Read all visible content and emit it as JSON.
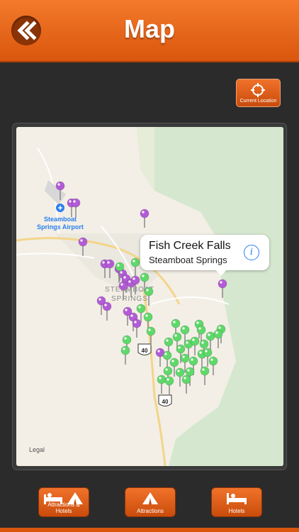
{
  "header": {
    "title": "Map",
    "back_icon": "double-chevron-left-icon"
  },
  "current_location": {
    "label": "Current Location",
    "icon": "crosshair-icon"
  },
  "map": {
    "airport_label_1": "Steamboat",
    "airport_label_2": "Springs Airport",
    "city_label_1": "STEAMBOAT",
    "city_label_2": "SPRINGS",
    "route_40": "40",
    "route_40b": "40",
    "legal": "Legal"
  },
  "callout": {
    "title": "Fish Creek Falls",
    "subtitle": "Steamboat Springs"
  },
  "toolbar": {
    "attractions_hotels": "Attractions & Hotels",
    "attractions": "Attractions",
    "hotels": "Hotels"
  },
  "colors": {
    "accent": "#e8661e",
    "pin_purple": "#b35bd6",
    "pin_green": "#5ed96a"
  }
}
